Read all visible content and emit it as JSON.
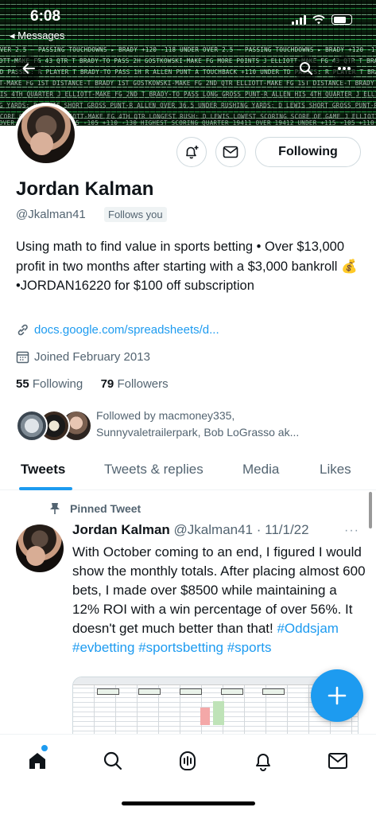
{
  "status_bar": {
    "time": "6:08",
    "back_label": "◂ Messages"
  },
  "colors": {
    "accent": "#1d9bf0",
    "text": "#0f1419",
    "muted": "#536471",
    "border": "#cfd9de"
  },
  "banner": {
    "rows": [
      "OVER 2.5 — PASSING TOUCHDOWNS ▸ BRADY  +120  -118  UNDER",
      "J ELLIOTT-MAKE FG 43 QTR  T BRADY-TO PASS 2H  GOSTKOWSKI-MAKE FG  MORE POINTS",
      "TD PASSES: R PLAYER  T BRADY-TO PASS 1H  R ALLEN PUNT A TOUCHBACK  +110 UNDER",
      "ELLIOTT-MAKE FG 1ST  DISTANCE-T BRADY 1ST  GOSTKOWSKI-MAKE FG 2ND QTR",
      "HIS 4TH QUARTER  J ELLIOTT-MAKE FG 2ND  T BRADY-TO PASS  LONG GROSS PUNT-R ALLEN",
      "RUSHING YARDS: D LEWIS  SHORT GROSS PUNT-R ALLEN  OVER 36.5 UNDER",
      "SCORE OF GAME  J ELLIOTT-MAKE FG 4TH QTR  LONGEST RUSH: D LEWIS  LOWEST SCORING",
      "19411 OVER  19412 UNDER  +115 -105  +110 -130  HIGHEST SCORING QUARTER"
    ]
  },
  "profile": {
    "name": "Jordan Kalman",
    "handle": "@Jkalman41",
    "follows_you": "Follows you",
    "follow_button": "Following",
    "bio_prefix": "Using math to find value in sports betting • Over $13,000 profit in two months after starting with a $3,000 bankroll ",
    "bio_emoji": "💰",
    "bio_suffix": " •JORDAN16220 for $100 off subscription",
    "link": "docs.google.com/spreadsheets/d...",
    "joined": "Joined February 2013",
    "following_count": "55",
    "following_label": "Following",
    "followers_count": "79",
    "followers_label": "Followers",
    "followed_by_line1": "Followed by macmoney335,",
    "followed_by_line2": "Sunnyvaletrailerpark, Bob LoGrasso ak..."
  },
  "tabs": [
    {
      "label": "Tweets",
      "active": true
    },
    {
      "label": "Tweets & replies",
      "active": false
    },
    {
      "label": "Media",
      "active": false
    },
    {
      "label": "Likes",
      "active": false
    }
  ],
  "tweet": {
    "pinned_label": "Pinned Tweet",
    "author": "Jordan Kalman",
    "handle_date": "@Jkalman41 · 11/1/22",
    "more": "···",
    "text": "With October coming to an end, I figured I would show the monthly totals. After placing almost 600 bets, I made over $8500 while maintaining a 12% ROI with a win percentage of over 56%. It doesn't get much better than that! ",
    "hashtags": [
      "#Oddsjam",
      "#evbetting",
      "#sportsbetting",
      "#sports"
    ]
  },
  "nav": {
    "items": [
      "home-icon",
      "search-icon",
      "spaces-icon",
      "notifications-icon",
      "messages-icon"
    ]
  },
  "icons": {
    "fab": "plus-icon",
    "bell": "bell-plus-icon",
    "mail": "mail-icon",
    "back": "arrow-left-icon",
    "search": "search-icon",
    "more": "more-icon",
    "link": "link-icon",
    "calendar": "calendar-icon",
    "pin": "pin-icon"
  }
}
